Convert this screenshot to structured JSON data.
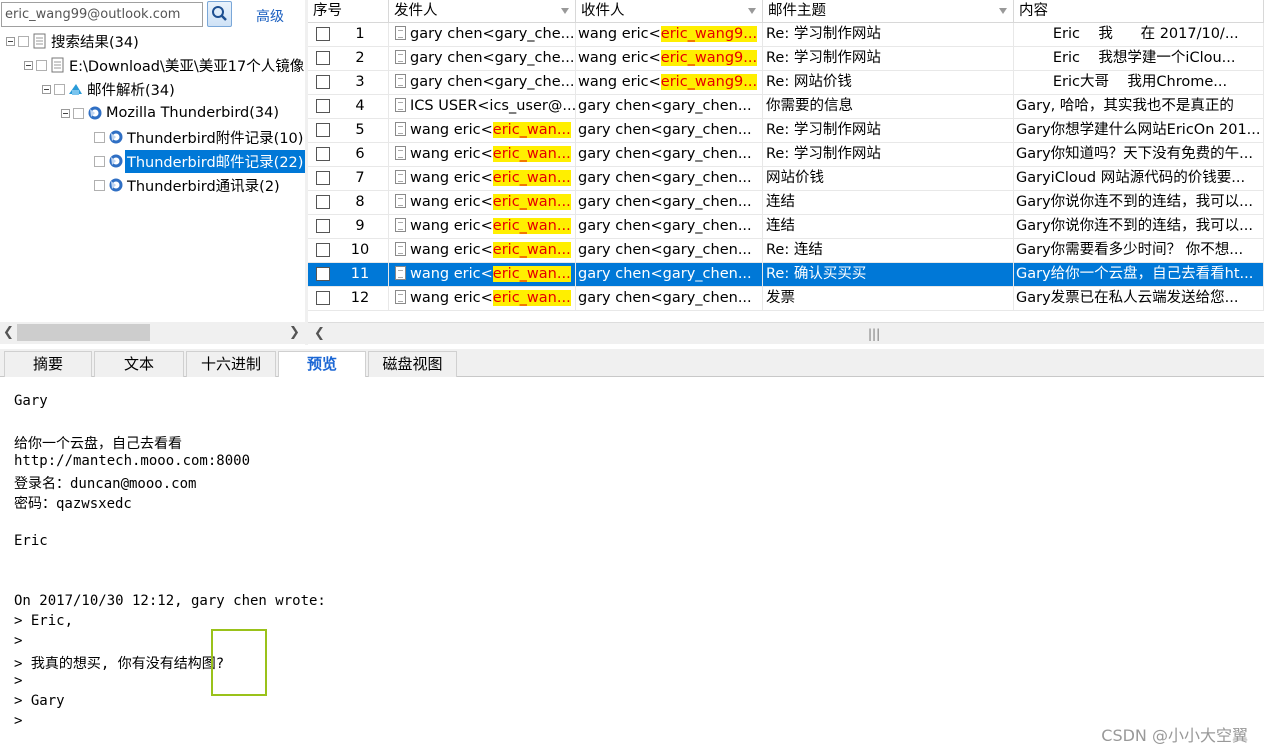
{
  "search": {
    "value": "eric_wang99@outlook.com",
    "advanced_label": "高级"
  },
  "tree": {
    "root": "搜索结果(34)",
    "source": "E:\\Download\\美亚\\美亚17个人镜像",
    "mail_parse": "邮件解析(34)",
    "thunderbird": "Mozilla Thunderbird(34)",
    "items": [
      "Thunderbird附件记录(10)",
      "Thunderbird邮件记录(22)",
      "Thunderbird通讯录(2)"
    ]
  },
  "grid": {
    "columns": [
      "序号",
      "发件人",
      "收件人",
      "邮件主题",
      "内容"
    ],
    "rows": [
      {
        "n": "1",
        "from": "gary chen<gary_che...",
        "from_hl": "",
        "to": "wang eric<",
        "to_hl": "eric_wang9...",
        "subject": "Re: 学习制作网站",
        "content": "        Eric    我      在 2017/10/..."
      },
      {
        "n": "2",
        "from": "gary chen<gary_che...",
        "from_hl": "",
        "to": "wang eric<",
        "to_hl": "eric_wang9...",
        "subject": "Re: 学习制作网站",
        "content": "        Eric    我想学建一个iClou..."
      },
      {
        "n": "3",
        "from": "gary chen<gary_che...",
        "from_hl": "",
        "to": "wang eric<",
        "to_hl": "eric_wang9...",
        "subject": "Re: 网站价钱",
        "content": "        Eric大哥    我用Chrome..."
      },
      {
        "n": "4",
        "from": "ICS USER<ics_user@...",
        "from_hl": "",
        "to": "gary chen<gary_chen...",
        "to_hl": "",
        "subject": "你需要的信息",
        "content": "Gary, 哈哈，其实我也不是真正的"
      },
      {
        "n": "5",
        "from": "wang eric<",
        "from_hl": "eric_wan...",
        "to": "gary chen<gary_chen...",
        "to_hl": "",
        "subject": "Re: 学习制作网站",
        "content": "Gary你想学建什么网站EricOn 201..."
      },
      {
        "n": "6",
        "from": "wang eric<",
        "from_hl": "eric_wan...",
        "to": "gary chen<gary_chen...",
        "to_hl": "",
        "subject": "Re: 学习制作网站",
        "content": "Gary你知道吗？天下没有免费的午..."
      },
      {
        "n": "7",
        "from": "wang eric<",
        "from_hl": "eric_wan...",
        "to": "gary chen<gary_chen...",
        "to_hl": "",
        "subject": "网站价钱",
        "content": "GaryiCloud 网站源代码的价钱要..."
      },
      {
        "n": "8",
        "from": "wang eric<",
        "from_hl": "eric_wan...",
        "to": "gary chen<gary_chen...",
        "to_hl": "",
        "subject": "连结",
        "content": "Gary你说你连不到的连结，我可以..."
      },
      {
        "n": "9",
        "from": "wang eric<",
        "from_hl": "eric_wan...",
        "to": "gary chen<gary_chen...",
        "to_hl": "",
        "subject": "连结",
        "content": "Gary你说你连不到的连结，我可以..."
      },
      {
        "n": "10",
        "from": "wang eric<",
        "from_hl": "eric_wan...",
        "to": "gary chen<gary_chen...",
        "to_hl": "",
        "subject": "Re: 连结",
        "content": "Gary你需要看多少时间？ 你不想..."
      },
      {
        "n": "11",
        "from": "wang eric<",
        "from_hl": "eric_wan...",
        "to": "gary chen<gary_chen...",
        "to_hl": "",
        "subject": "Re: 确认买买买",
        "content": "Gary给你一个云盘，自己去看看ht..."
      },
      {
        "n": "12",
        "from": "wang eric<",
        "from_hl": "eric_wan...",
        "to": "gary chen<gary_chen...",
        "to_hl": "",
        "subject": "发票",
        "content": "Gary发票已在私人云端发送给您..."
      }
    ]
  },
  "tabs": [
    "摘要",
    "文本",
    "十六进制",
    "预览",
    "磁盘视图"
  ],
  "preview": {
    "lines": [
      "Gary",
      "",
      "给你一个云盘，自己去看看",
      "http://mantech.mooo.com:8000",
      "登录名：duncan@mooo.com",
      "密码：qazwsxedc",
      "",
      "Eric",
      "",
      "",
      "On 2017/10/30 12:12, gary chen wrote:",
      "> Eric,",
      ">",
      "> 我真的想买, 你有没有结构图?",
      ">",
      "> Gary",
      ">"
    ]
  },
  "watermark": "CSDN @小小大空翼"
}
